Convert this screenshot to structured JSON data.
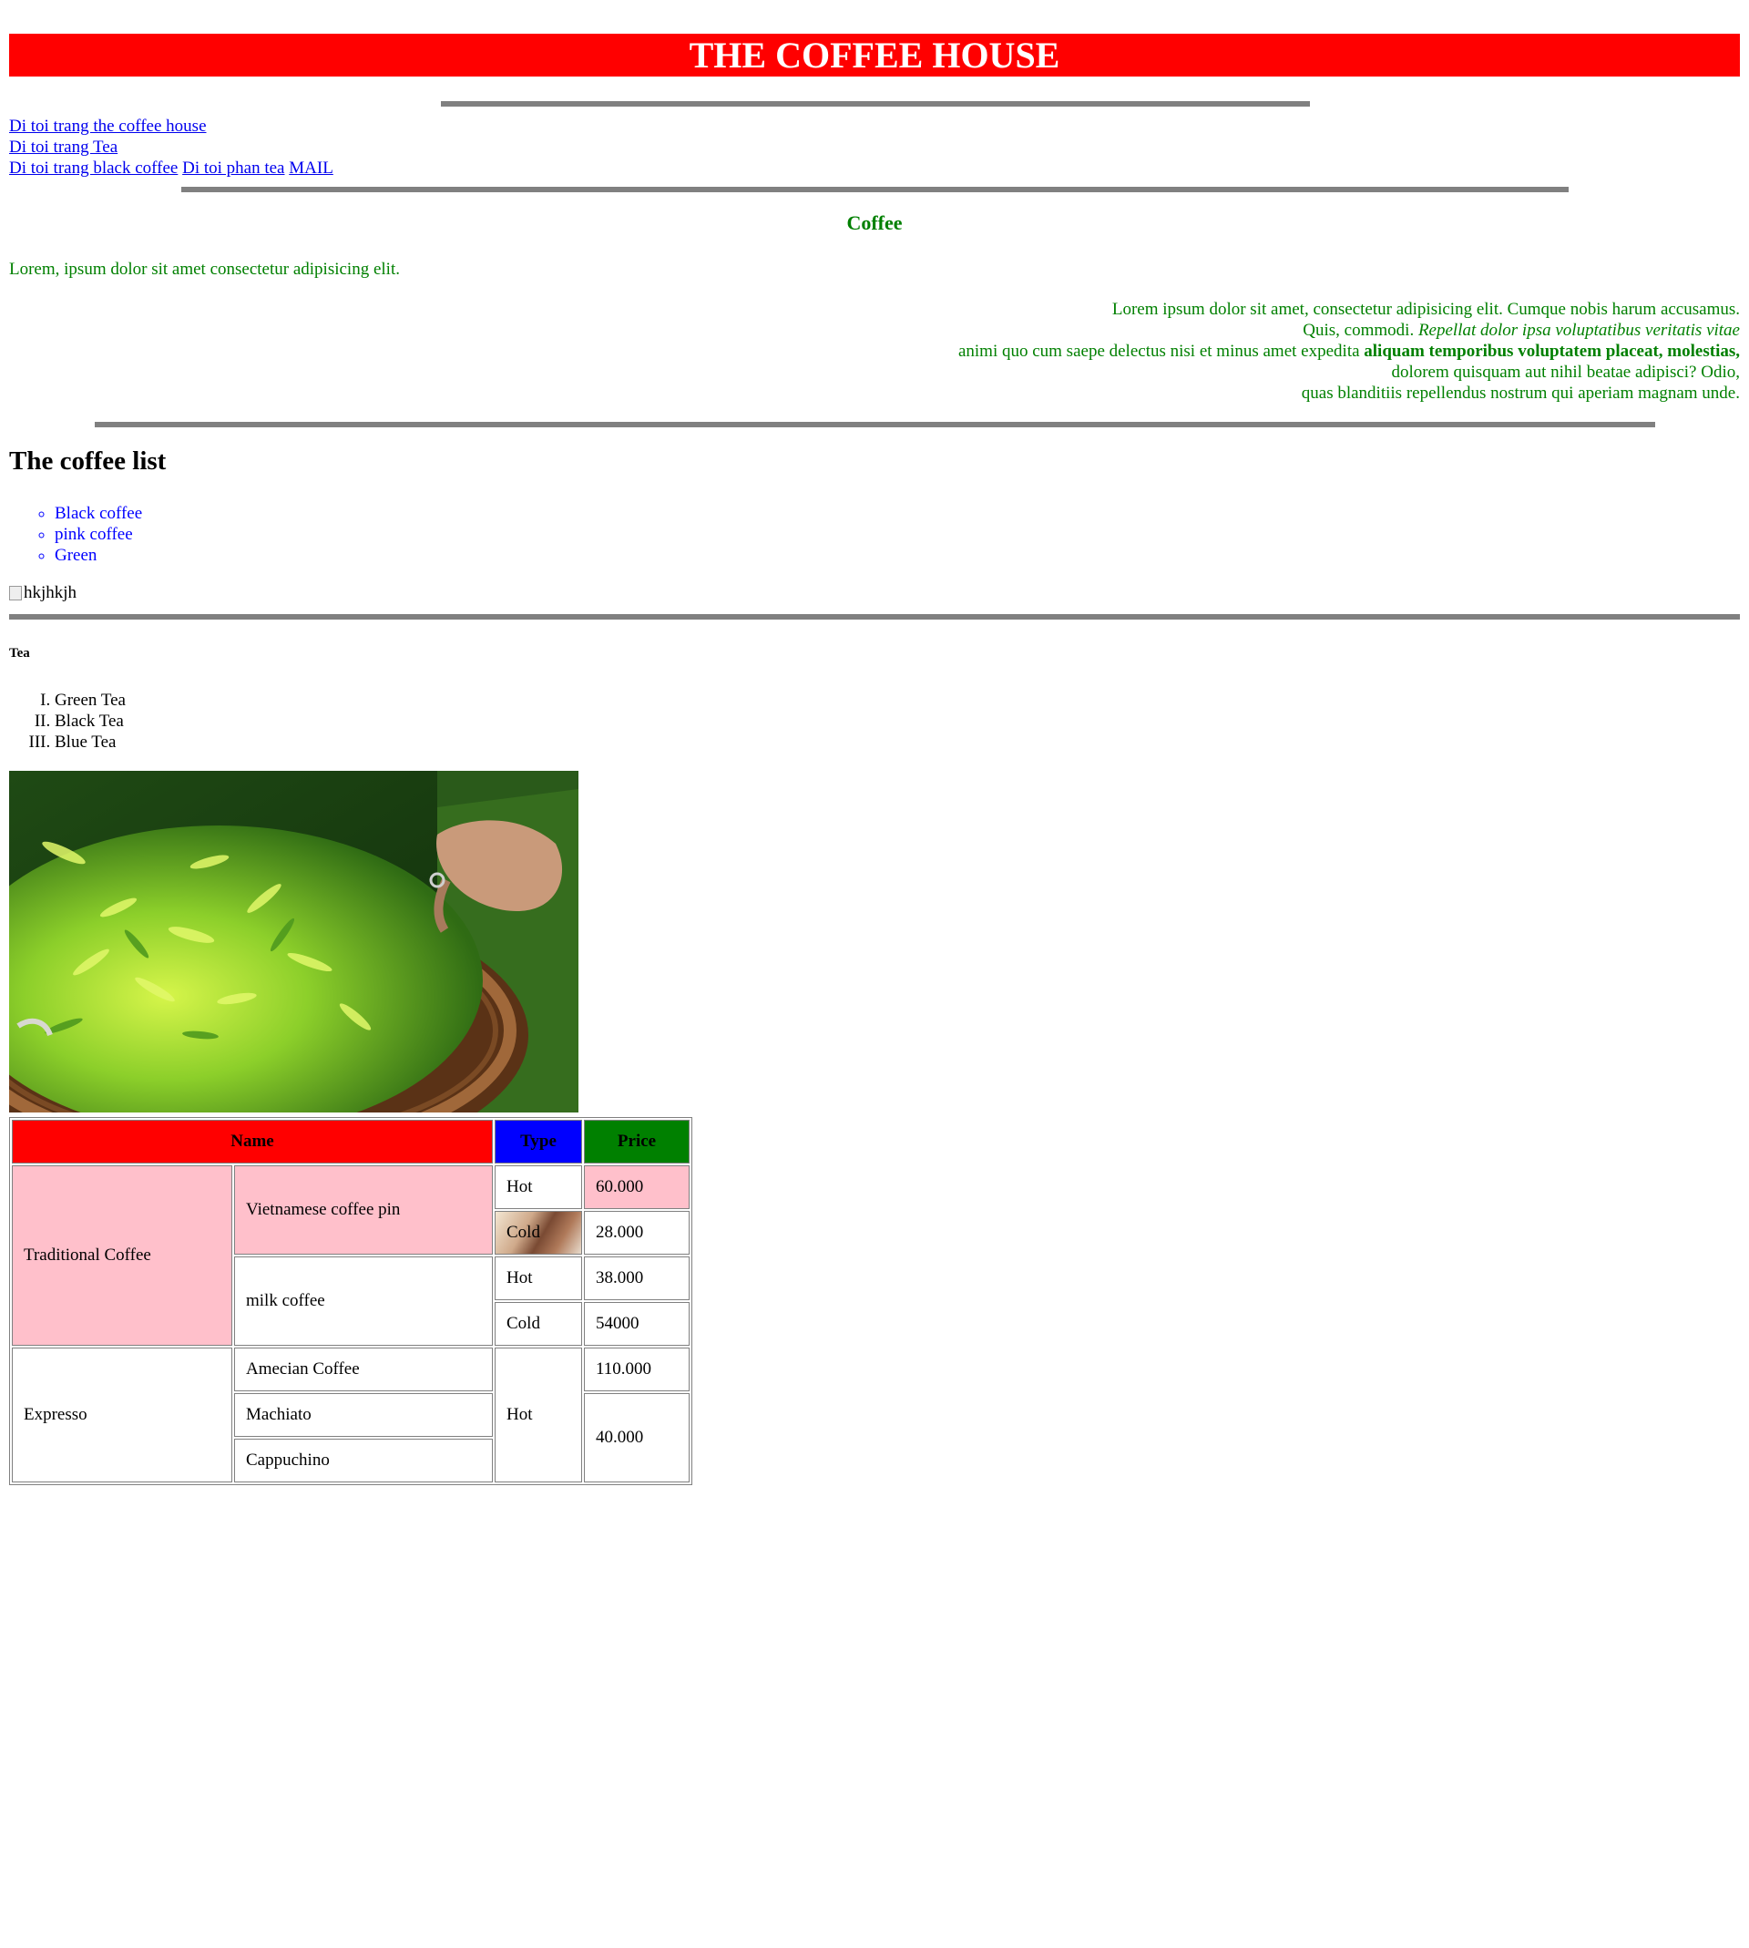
{
  "header": {
    "title": "THE COFFEE HOUSE"
  },
  "nav": {
    "links": [
      "Di toi trang the coffee house",
      "Di toi trang Tea",
      "Di toi trang black coffee",
      "Di toi phan tea",
      "MAIL"
    ]
  },
  "coffee_section": {
    "heading": "Coffee",
    "intro": "Lorem, ipsum dolor sit amet consectetur adipisicing elit.",
    "paragraph": {
      "line1": "Lorem ipsum dolor sit amet, consectetur adipisicing elit. Cumque nobis harum accusamus.",
      "line2_plain": "Quis, commodi.",
      "line2_italic": "Repellat dolor ipsa voluptatibus veritatis vitae",
      "line3_plain": "animi quo cum saepe delectus nisi et minus amet expedita",
      "line3_bold": "aliquam temporibus voluptatem placeat, molestias,",
      "line4": "dolorem quisquam aut nihil beatae adipisci? Odio,",
      "line5": "quas blanditiis repellendus nostrum qui aperiam magnam unde."
    }
  },
  "coffee_list": {
    "heading": "The coffee list",
    "items": [
      "Black coffee",
      "pink coffee",
      "Green"
    ],
    "image_alt": "hkjhkjh"
  },
  "tea_section": {
    "heading": "Tea",
    "items": [
      "Green Tea",
      "Black Tea",
      "Blue Tea"
    ]
  },
  "menu_table": {
    "headers": {
      "name": "Name",
      "type": "Type",
      "price": "Price"
    },
    "groups": {
      "traditional": "Traditional Coffee",
      "expresso": "Expresso"
    },
    "items": {
      "vn_pin": "Vietnamese coffee pin",
      "milk": "milk coffee",
      "amecian": "Amecian Coffee",
      "machiato": "Machiato",
      "cappuchino": "Cappuchino"
    },
    "types": {
      "hot": "Hot",
      "cold": "Cold"
    },
    "prices": {
      "vn_pin_hot": "60.000",
      "vn_pin_cold": "28.000",
      "milk_hot": "38.000",
      "milk_cold": "54000",
      "amecian": "110.000",
      "machiato_cappuchino": "40.000"
    },
    "colors": {
      "name_header": "#ff0000",
      "type_header": "#0000ff",
      "price_header": "#008000",
      "highlight": "#ffc0cb"
    }
  },
  "colors": {
    "title_bar": "#ff0000",
    "title_text": "#ffffff",
    "section_text": "#008000",
    "link": "#0000ee",
    "list_text": "#0000ff",
    "rule": "#808080"
  }
}
